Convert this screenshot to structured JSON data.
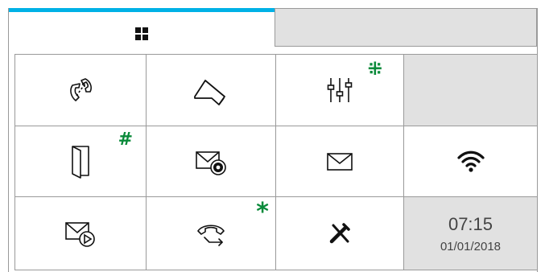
{
  "tabs": [
    {
      "icon": "grid-icon",
      "active": true
    },
    {
      "icon": "",
      "active": false
    }
  ],
  "tiles": [
    {
      "icon": "call-forward-handset-icon"
    },
    {
      "icon": "camera-icon"
    },
    {
      "icon": "equalizer-settings-icon",
      "badge": "⁜"
    },
    {
      "icon": "",
      "disabled": true
    },
    {
      "icon": "door-icon",
      "badge": "#"
    },
    {
      "icon": "mail-settings-icon"
    },
    {
      "icon": "mail-icon"
    },
    {
      "icon": "wifi-icon"
    },
    {
      "icon": "mail-play-icon"
    },
    {
      "icon": "call-transfer-icon",
      "badge": "*"
    },
    {
      "icon": "tools-icon"
    },
    {
      "icon": "clock-icon"
    }
  ],
  "clock": {
    "time": "07:15",
    "date": "01/01/2018"
  },
  "colors": {
    "accent": "#00b1e6",
    "badge": "#0a8a3a",
    "tile_disabled": "#e1e1e1"
  }
}
